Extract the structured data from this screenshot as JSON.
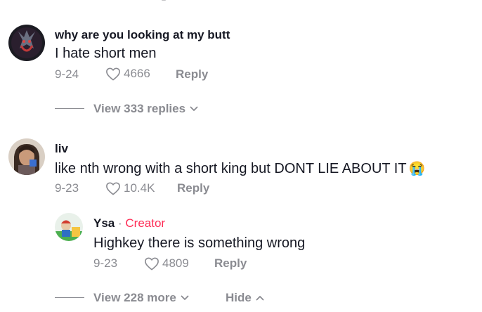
{
  "comments": [
    {
      "username": "why are you looking at my butt",
      "text": "I hate short men",
      "date": "9-24",
      "likes": "4666",
      "reply_label": "Reply",
      "view_replies": "View 333 replies"
    },
    {
      "username": "liv",
      "text": "like nth wrong with a short king but DONT LIE ABOUT IT",
      "emoji": "😭",
      "date": "9-23",
      "likes": "10.4K",
      "reply_label": "Reply"
    }
  ],
  "reply": {
    "username": "Ysa",
    "separator": "·",
    "badge": "Creator",
    "text": "Highkey there is something wrong",
    "date": "9-23",
    "likes": "4809",
    "reply_label": "Reply"
  },
  "thread_controls": {
    "view_more": "View 228 more",
    "hide": "Hide"
  },
  "colors": {
    "text_primary": "#161823",
    "text_secondary": "#8a8b91",
    "creator_accent": "#fe2c55"
  },
  "icons": [
    "heart-outline-icon",
    "chevron-down-icon",
    "chevron-up-icon"
  ]
}
